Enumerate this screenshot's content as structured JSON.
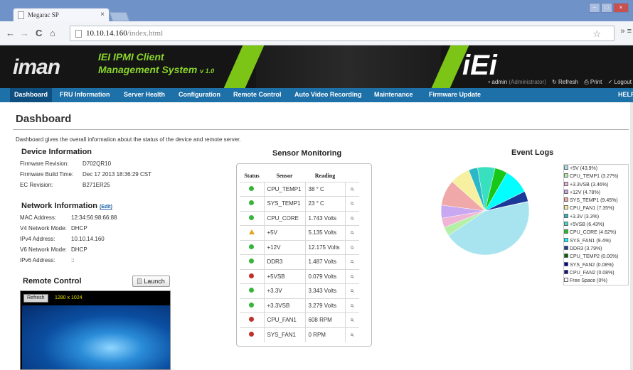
{
  "browser": {
    "tab_title": "Megarac SP",
    "tab_close": "×",
    "url_host": "10.10.14.160",
    "url_path": "/index.html",
    "nav_back": "←",
    "nav_forward": "→",
    "nav_reload": "C",
    "nav_home": "⌂",
    "star": "☆",
    "menu": "» ≡"
  },
  "banner": {
    "logo": "iman",
    "title": "IEI IPMI Client",
    "subtitle": "Management System",
    "version": "v 1.0",
    "brand": "iEi",
    "user": "admin",
    "role": "(Administrator)",
    "refresh": "Refresh",
    "print": "Print",
    "logout": "Logout"
  },
  "nav": {
    "items": [
      "Dashboard",
      "FRU Information",
      "Server Health",
      "Configuration",
      "Remote Control",
      "Auto Video Recording",
      "Maintenance",
      "Firmware Update"
    ],
    "help": "HELP"
  },
  "page": {
    "title": "Dashboard",
    "description": "Dashboard gives the overall information about the status of the device and remote server."
  },
  "device": {
    "title": "Device Information",
    "firmware_revision_label": "Firmware Revision:",
    "firmware_revision": "D702QR10",
    "build_time_label": "Firmware Build Time:",
    "build_time": "Dec 17 2013 18:36:29 CST",
    "ec_label": "EC Revision:",
    "ec": "B271ER25"
  },
  "network": {
    "title": "Network Information",
    "edit": "(Edit)",
    "mac_label": "MAC Address:",
    "mac": "12:34:56:98:66:88",
    "v4_mode_label": "V4 Network Mode:",
    "v4_mode": "DHCP",
    "ipv4_label": "IPv4 Address:",
    "ipv4": "10.10.14.160",
    "v6_mode_label": "V6 Network Mode:",
    "v6_mode": "DHCP",
    "ipv6_label": "IPv6 Address:",
    "ipv6": "::"
  },
  "remote": {
    "title": "Remote Control",
    "launch": "Launch",
    "refresh": "Refresh",
    "resolution": "1280 x 1024"
  },
  "sensors": {
    "title": "Sensor Monitoring",
    "headers": [
      "Status",
      "Sensor",
      "Reading"
    ],
    "rows": [
      {
        "status": "ok",
        "name": "CPU_TEMP1",
        "reading": "38 ° C"
      },
      {
        "status": "ok",
        "name": "SYS_TEMP1",
        "reading": "23 ° C"
      },
      {
        "status": "ok",
        "name": "CPU_CORE",
        "reading": "1.743 Volts"
      },
      {
        "status": "warn",
        "name": "+5V",
        "reading": "5.135 Volts"
      },
      {
        "status": "ok",
        "name": "+12V",
        "reading": "12.175 Volts"
      },
      {
        "status": "ok",
        "name": "DDR3",
        "reading": "1.487 Volts"
      },
      {
        "status": "crit",
        "name": "+5VSB",
        "reading": "0.079 Volts"
      },
      {
        "status": "ok",
        "name": "+3.3V",
        "reading": "3.343 Volts"
      },
      {
        "status": "ok",
        "name": "+3.3VSB",
        "reading": "3.279 Volts"
      },
      {
        "status": "crit",
        "name": "CPU_FAN1",
        "reading": "608 RPM"
      },
      {
        "status": "crit",
        "name": "SYS_FAN1",
        "reading": "0 RPM"
      }
    ],
    "status_colors": {
      "ok": "#37b53a",
      "warn": "#e2a21a",
      "crit": "#c0302a"
    }
  },
  "events": {
    "title": "Event Logs",
    "legend": [
      {
        "label": "+5V (43.9%)",
        "color": "#a8e4f0"
      },
      {
        "label": "CPU_TEMP1 (3.27%)",
        "color": "#b6f0a8"
      },
      {
        "label": "+3.3VSB (3.46%)",
        "color": "#f0b4d6"
      },
      {
        "label": "+12V (4.78%)",
        "color": "#c8a8f0"
      },
      {
        "label": "SYS_TEMP1 (9.45%)",
        "color": "#f0a8a8"
      },
      {
        "label": "CPU_FAN1 (7.35%)",
        "color": "#f6f0a0"
      },
      {
        "label": "+3.3V (3.3%)",
        "color": "#2ab8c8"
      },
      {
        "label": "+5VSB (6.43%)",
        "color": "#38e0c0"
      },
      {
        "label": "CPU_CORE (4.62%)",
        "color": "#18c818"
      },
      {
        "label": "SYS_FAN1 (9.4%)",
        "color": "#00ffff"
      },
      {
        "label": "DDR3 (3.79%)",
        "color": "#1a3a9a"
      },
      {
        "label": "CPU_TEMP2 (0.00%)",
        "color": "#006400"
      },
      {
        "label": "SYS_FAN2 (0.08%)",
        "color": "#0000a0"
      },
      {
        "label": "CPU_FAN2 (0.08%)",
        "color": "#10108a"
      },
      {
        "label": "Free Space (0%)",
        "color": "#ffffff"
      }
    ]
  },
  "chart_data": {
    "type": "pie",
    "title": "Event Logs",
    "categories": [
      "+5V",
      "CPU_TEMP1",
      "+3.3VSB",
      "+12V",
      "SYS_TEMP1",
      "CPU_FAN1",
      "+3.3V",
      "+5VSB",
      "CPU_CORE",
      "SYS_FAN1",
      "DDR3",
      "CPU_TEMP2",
      "SYS_FAN2",
      "CPU_FAN2",
      "Free Space"
    ],
    "values": [
      43.9,
      3.27,
      3.46,
      4.78,
      9.45,
      7.35,
      3.3,
      6.43,
      4.62,
      9.4,
      3.79,
      0.0,
      0.08,
      0.08,
      0
    ],
    "legend": "right"
  }
}
